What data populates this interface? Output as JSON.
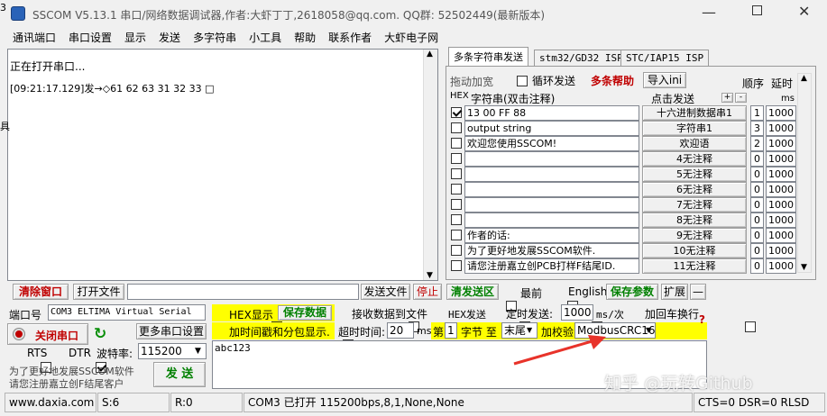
{
  "window": {
    "title": "SSCOM V5.13.1 串口/网络数据调试器,作者:大虾丁丁,2618058@qq.com. QQ群: 52502449(最新版本)",
    "corner_label": "3."
  },
  "menu": [
    "通讯端口",
    "串口设置",
    "显示",
    "发送",
    "多字符串",
    "小工具",
    "帮助",
    "联系作者",
    "大虾电子网"
  ],
  "receive": {
    "line1": "正在打开串口...",
    "line2": "[09:21:17.129]发→◇61 62 63 31 32 33 □"
  },
  "tabs": [
    "多条字符串发送",
    "stm32/GD32 ISP",
    "STC/IAP15 ISP"
  ],
  "multi": {
    "drag_label": "拖动加宽",
    "loop_label": "循环发送",
    "help_label": "多条帮助",
    "import_label": "导入ini",
    "order_header": "顺序",
    "delay_header": "延时",
    "hex_header": "HEX",
    "string_header": "字符串(双击注释)",
    "click_send_header": "点击发送",
    "ms_header": "ms",
    "plus": "+",
    "minus": "-"
  },
  "rows": [
    {
      "hex": true,
      "text": "13 00 FF 88",
      "button": "十六进制数据串1",
      "order": "1",
      "delay": "1000"
    },
    {
      "hex": false,
      "text": "output string",
      "button": "字符串1",
      "order": "3",
      "delay": "1000"
    },
    {
      "hex": false,
      "text": "欢迎您使用SSCOM!",
      "button": "欢迎语",
      "order": "2",
      "delay": "1000"
    },
    {
      "hex": false,
      "text": "",
      "button": "4无注释",
      "order": "0",
      "delay": "1000"
    },
    {
      "hex": false,
      "text": "",
      "button": "5无注释",
      "order": "0",
      "delay": "1000"
    },
    {
      "hex": false,
      "text": "",
      "button": "6无注释",
      "order": "0",
      "delay": "1000"
    },
    {
      "hex": false,
      "text": "",
      "button": "7无注释",
      "order": "0",
      "delay": "1000"
    },
    {
      "hex": false,
      "text": "",
      "button": "8无注释",
      "order": "0",
      "delay": "1000"
    },
    {
      "hex": false,
      "text": "作者的话:",
      "button": "9无注释",
      "order": "0",
      "delay": "1000"
    },
    {
      "hex": false,
      "text": "为了更好地发展SSCOM软件.",
      "button": "10无注释",
      "order": "0",
      "delay": "1000"
    },
    {
      "hex": false,
      "text": "请您注册嘉立创PCB打样F结尾ID.",
      "button": "11无注释",
      "order": "0",
      "delay": "1000"
    }
  ],
  "toolbar": {
    "clear": "清除窗口",
    "open_file": "打开文件",
    "send_file": "发送文件",
    "stop": "停止",
    "clear_send": "清发送区",
    "topmost": "最前",
    "english": "English",
    "save_params": "保存参数",
    "expand": "扩展",
    "dash": "—"
  },
  "port": {
    "label": "端口号",
    "value": "COM3 ELTIMA Virtual Serial",
    "close_btn": "关闭串口",
    "more_settings": "更多串口设置",
    "rts": "RTS",
    "dtr": "DTR",
    "baud_label": "波特率:",
    "baud": "115200"
  },
  "options": {
    "hex_show": "HEX显示",
    "save_data": "保存数据",
    "recv_to_file": "接收数据到文件",
    "hex_send": "HEX发送",
    "timed_send": "定时发送:",
    "period": "1000",
    "period_unit": "ms/次",
    "add_crlf": "加回车换行",
    "add_timestamp": "加时间戳和分包显示.",
    "timeout_label": "超时时间:",
    "timeout": "20",
    "ms": "ms",
    "byte_prefix": "第",
    "byte_from": "1",
    "byte_mid": "字节 至",
    "byte_to": "末尾",
    "checksum_label": "加校验",
    "checksum": "ModbusCRC16",
    "question": "?"
  },
  "send": {
    "text": "abc123",
    "button": "发 送",
    "promo1": "为了更好地发展SSCOM软件",
    "promo2": "请您注册嘉立创F结尾客户"
  },
  "status": {
    "site": "www.daxia.com",
    "sent": "S:6",
    "recv": "R:0",
    "port_status": "COM3 已打开  115200bps,8,1,None,None",
    "signals": "CTS=0 DSR=0 RLSD"
  },
  "watermark": "知乎 @玩转Github",
  "colors": {
    "arrow": "#e8332a",
    "link_red": "#c00000",
    "green": "#008000",
    "yellow": "#ffff00"
  }
}
